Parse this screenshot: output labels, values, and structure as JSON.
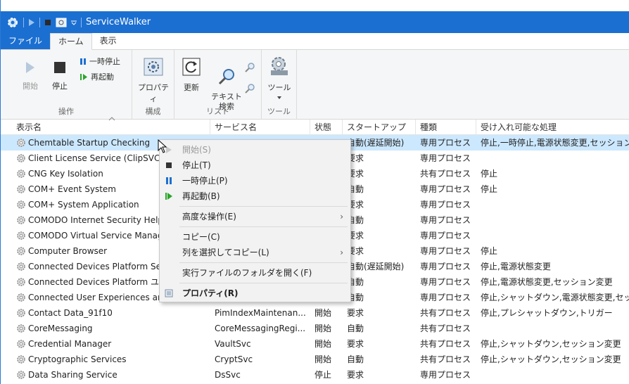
{
  "app": {
    "title": "ServiceWalker"
  },
  "tabs": [
    {
      "label": "ファイル"
    },
    {
      "label": "ホーム"
    },
    {
      "label": "表示"
    }
  ],
  "ribbon": {
    "start": "開始",
    "stop": "停止",
    "pause": "一時停止",
    "restart": "再起動",
    "properties": "プロパティ",
    "refresh": "更新",
    "text_search": "テキスト\n検索",
    "tools": "ツール",
    "group_ops": "操作",
    "group_config": "構成",
    "group_list": "リスト",
    "group_tools": "ツール"
  },
  "columns": [
    "表示名",
    "サービス名",
    "状態",
    "スタートアップ",
    "種類",
    "受け入れ可能な処理"
  ],
  "rows": [
    {
      "name": "Chemtable Startup Checking",
      "svc": "",
      "state": "",
      "startup": "自動(遅延開始)",
      "type": "専用プロセス",
      "accept": "停止,一時停止,電源状態変更,セッション"
    },
    {
      "name": "Client License Service (ClipSVC)",
      "svc": "",
      "state": "",
      "startup": "要求",
      "type": "専用プロセス",
      "accept": ""
    },
    {
      "name": "CNG Key Isolation",
      "svc": "",
      "state": "",
      "startup": "要求",
      "type": "共有プロセス",
      "accept": "停止"
    },
    {
      "name": "COM+ Event System",
      "svc": "",
      "state": "",
      "startup": "自動",
      "type": "専用プロセス",
      "accept": "停止"
    },
    {
      "name": "COM+ System Application",
      "svc": "",
      "state": "",
      "startup": "要求",
      "type": "専用プロセス",
      "accept": ""
    },
    {
      "name": "COMODO Internet Security Help",
      "svc": "",
      "state": "",
      "startup": "自動",
      "type": "専用プロセス",
      "accept": ""
    },
    {
      "name": "COMODO Virtual Service Manag",
      "svc": "",
      "state": "",
      "startup": "要求",
      "type": "専用プロセス",
      "accept": ""
    },
    {
      "name": "Computer Browser",
      "svc": "",
      "state": "",
      "startup": "要求",
      "type": "専用プロセス",
      "accept": "停止"
    },
    {
      "name": "Connected Devices Platform Ser",
      "svc": "",
      "state": "",
      "startup": "自動(遅延開始)",
      "type": "専用プロセス",
      "accept": "停止,電源状態変更"
    },
    {
      "name": "Connected Devices Platform ユー",
      "svc": "",
      "state": "",
      "startup": "自動",
      "type": "専用プロセス",
      "accept": "停止,電源状態変更,セッション変更"
    },
    {
      "name": "Connected User Experiences and",
      "svc": "",
      "state": "",
      "startup": "自動",
      "type": "専用プロセス",
      "accept": "停止,シャットダウン,電源状態変更,セッ"
    },
    {
      "name": "Contact Data_91f10",
      "svc": "PimIndexMaintenan...",
      "state": "開始",
      "startup": "要求",
      "type": "共有プロセス",
      "accept": "停止,プレシャットダウン,トリガー"
    },
    {
      "name": "CoreMessaging",
      "svc": "CoreMessagingRegi...",
      "state": "開始",
      "startup": "自動",
      "type": "共有プロセス",
      "accept": ""
    },
    {
      "name": "Credential Manager",
      "svc": "VaultSvc",
      "state": "開始",
      "startup": "要求",
      "type": "共有プロセス",
      "accept": "停止,シャットダウン,セッション変更"
    },
    {
      "name": "Cryptographic Services",
      "svc": "CryptSvc",
      "state": "開始",
      "startup": "自動",
      "type": "共有プロセス",
      "accept": "停止,シャットダウン,セッション変更"
    },
    {
      "name": "Data Sharing Service",
      "svc": "DsSvc",
      "state": "停止",
      "startup": "要求",
      "type": "専用プロセス",
      "accept": ""
    }
  ],
  "context_menu": {
    "start": "開始(S)",
    "stop": "停止(T)",
    "pause": "一時停止(P)",
    "restart": "再起動(B)",
    "advanced": "高度な操作(E)",
    "copy": "コピー(C)",
    "copy_cols": "列を選択してコピー(L)",
    "open_folder": "実行ファイルのフォルダを開く(F)",
    "properties": "プロパティ(R)"
  },
  "colors": {
    "accent": "#1b6fd1",
    "selection": "#cce8ff"
  }
}
